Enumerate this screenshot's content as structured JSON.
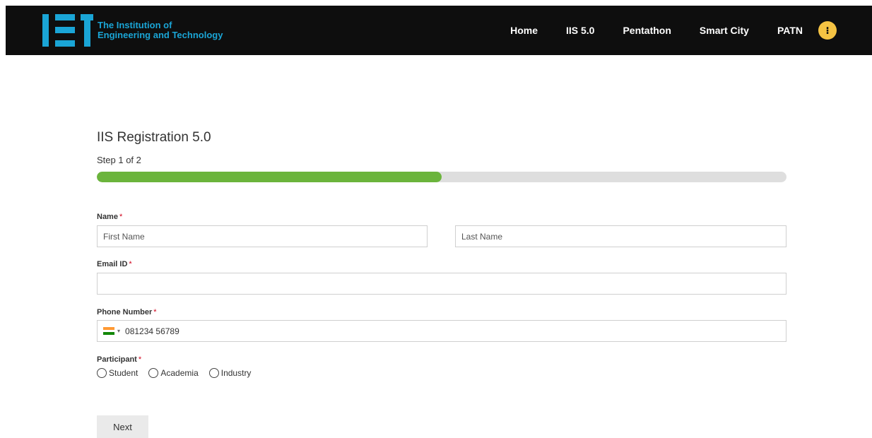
{
  "header": {
    "logo": {
      "line1": "The Institution of",
      "line2": "Engineering and Technology"
    },
    "nav": [
      {
        "label": "Home"
      },
      {
        "label": "IIS 5.0"
      },
      {
        "label": "Pentathon"
      },
      {
        "label": "Smart City"
      },
      {
        "label": "PATN"
      }
    ],
    "info_symbol": "⁝"
  },
  "form": {
    "title": "IIS Registration 5.0",
    "step_text": "Step 1 of 2",
    "progress_fraction": 0.5,
    "required_marker": "*",
    "name": {
      "label": "Name",
      "first_placeholder": "First Name",
      "last_placeholder": "Last Name"
    },
    "email": {
      "label": "Email ID",
      "value": ""
    },
    "phone": {
      "label": "Phone Number",
      "caret": "▾",
      "value": "081234 56789"
    },
    "participant": {
      "label": "Participant",
      "options": [
        "Student",
        "Academia",
        "Industry"
      ]
    },
    "next_label": "Next"
  },
  "colors": {
    "header_bg": "#0e0e0e",
    "brand_blue": "#1aa5d6",
    "progress_fill": "#6bb43c",
    "progress_track": "#dedede",
    "required": "#d0021b",
    "info_button": "#f5c343"
  },
  "icons": {
    "flag": "india-flag-icon",
    "info": "info-icon"
  }
}
